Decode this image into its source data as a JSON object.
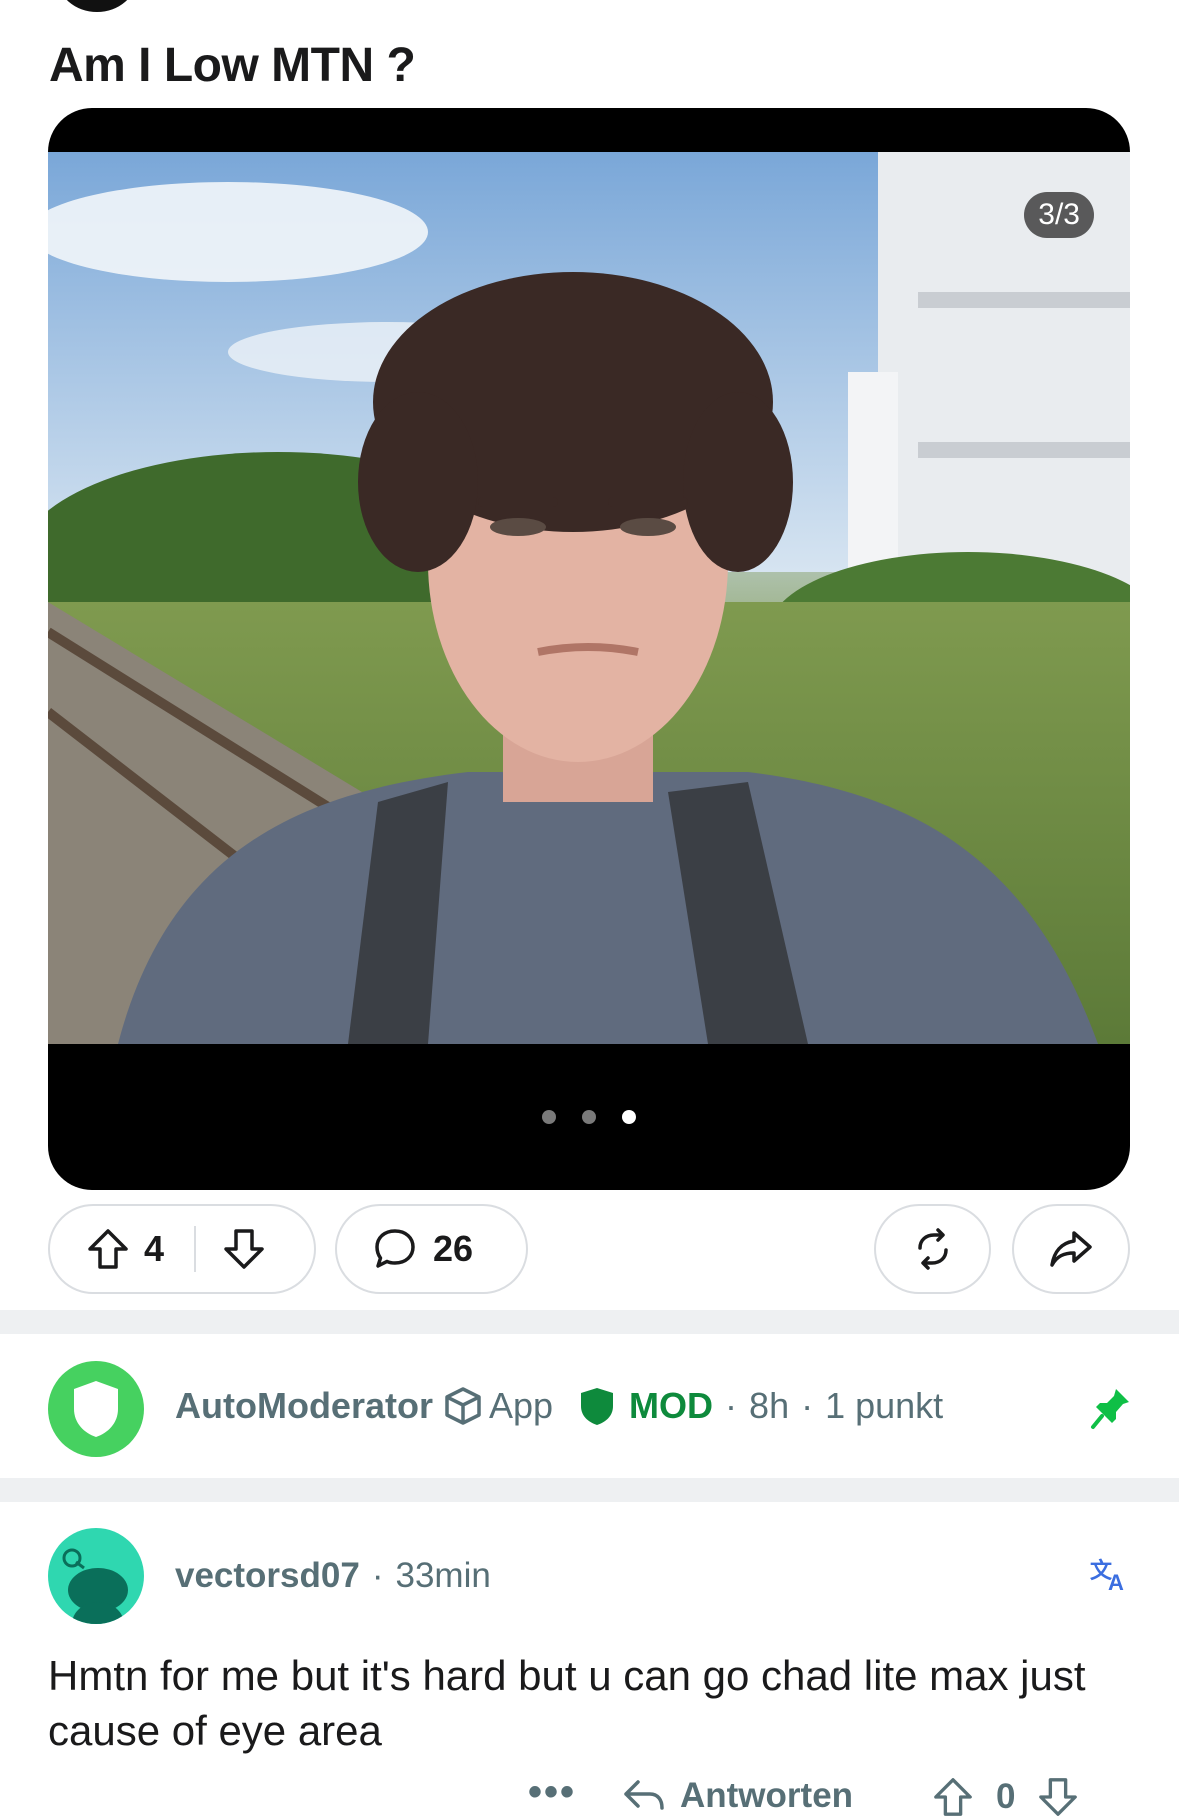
{
  "post": {
    "title": "Am I Low MTN ?",
    "gallery": {
      "counter": "3/3",
      "current_index": 3,
      "total": 3
    },
    "actions": {
      "upvotes": "4",
      "comments": "26"
    }
  },
  "automod_comment": {
    "author": "AutoModerator",
    "app_label": "App",
    "mod_label": "MOD",
    "age": "8h",
    "points": "1 punkt",
    "pinned_icon": "pin-icon",
    "accent_color": "#46d160"
  },
  "comment": {
    "author": "vectorsd07",
    "age": "33min",
    "body": "Hmtn for me but it's hard but u can go chad lite max just cause of eye area",
    "reply_label": "Antworten",
    "votes": "0",
    "translate_icon": "translate-icon",
    "avatar_color": "#2fd7b0"
  },
  "colors": {
    "mod_green": "#0e8a3c",
    "meta_gray": "#576f76",
    "pill_border": "#dadde1"
  }
}
